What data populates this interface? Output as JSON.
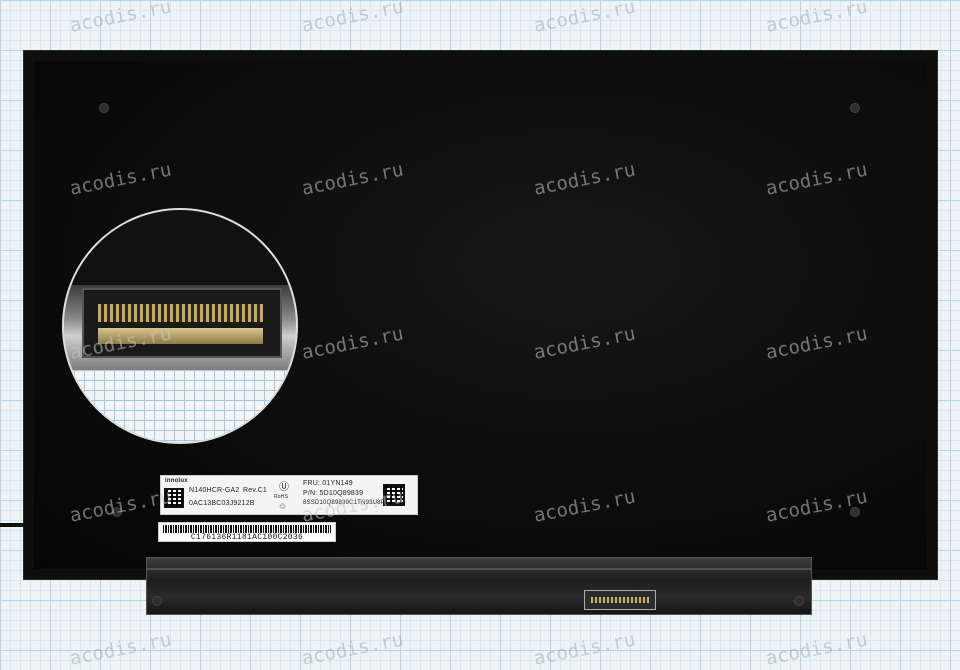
{
  "watermark": {
    "text": "acodis.ru"
  },
  "panel_label": {
    "brand": "innolux",
    "model": "N140HCR-GA2",
    "revision": "Rev.C1",
    "serial": "0AC13BC03J9212B",
    "fru": "FRU: 01YN149",
    "pn": "P/N: 5D10Q89839",
    "code": "8SSD10Q89839C1TN93U8PY",
    "cert_mark": "RoHS"
  },
  "barcode_label": {
    "text": "C176136R1181AC100C2036"
  }
}
